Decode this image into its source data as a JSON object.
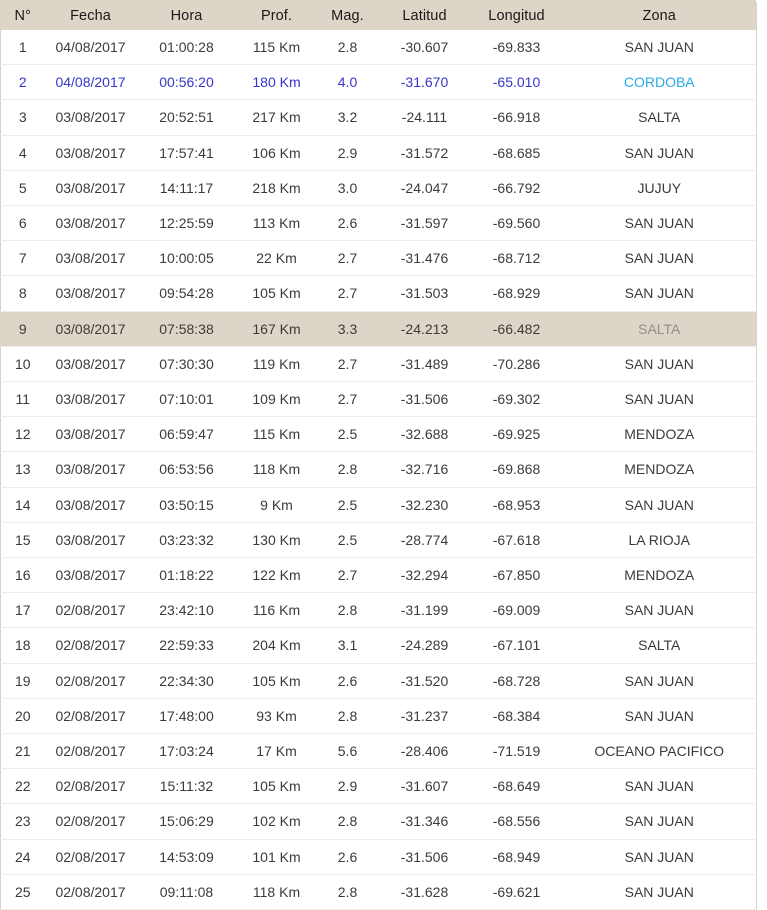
{
  "table": {
    "columns": [
      {
        "key": "num",
        "label": "N°"
      },
      {
        "key": "fecha",
        "label": "Fecha"
      },
      {
        "key": "hora",
        "label": "Hora"
      },
      {
        "key": "prof",
        "label": "Prof."
      },
      {
        "key": "mag",
        "label": "Mag."
      },
      {
        "key": "lat",
        "label": "Latitud"
      },
      {
        "key": "lon",
        "label": "Longitud"
      },
      {
        "key": "zona",
        "label": "Zona"
      }
    ],
    "colors": {
      "header_background": "#ddd5c7",
      "row_highlight_background": "#ddd5c7",
      "blue_row_text": "#3636cc",
      "blue_row_zone_text": "#2aabe4",
      "zone_text": "#8e8e8e",
      "body_text": "#3b3b3b",
      "row_separator": "#efece5"
    },
    "rows": [
      {
        "num": "1",
        "fecha": "04/08/2017",
        "hora": "01:00:28",
        "prof": "115 Km",
        "mag": "2.8",
        "lat": "-30.607",
        "lon": "-69.833",
        "zona": "SAN JUAN",
        "style": "normal"
      },
      {
        "num": "2",
        "fecha": "04/08/2017",
        "hora": "00:56:20",
        "prof": "180 Km",
        "mag": "4.0",
        "lat": "-31.670",
        "lon": "-65.010",
        "zona": "CORDOBA",
        "style": "blue"
      },
      {
        "num": "3",
        "fecha": "03/08/2017",
        "hora": "20:52:51",
        "prof": "217 Km",
        "mag": "3.2",
        "lat": "-24.111",
        "lon": "-66.918",
        "zona": "SALTA",
        "style": "normal"
      },
      {
        "num": "4",
        "fecha": "03/08/2017",
        "hora": "17:57:41",
        "prof": "106 Km",
        "mag": "2.9",
        "lat": "-31.572",
        "lon": "-68.685",
        "zona": "SAN JUAN",
        "style": "normal"
      },
      {
        "num": "5",
        "fecha": "03/08/2017",
        "hora": "14:11:17",
        "prof": "218 Km",
        "mag": "3.0",
        "lat": "-24.047",
        "lon": "-66.792",
        "zona": "JUJUY",
        "style": "normal"
      },
      {
        "num": "6",
        "fecha": "03/08/2017",
        "hora": "12:25:59",
        "prof": "113 Km",
        "mag": "2.6",
        "lat": "-31.597",
        "lon": "-69.560",
        "zona": "SAN JUAN",
        "style": "normal"
      },
      {
        "num": "7",
        "fecha": "03/08/2017",
        "hora": "10:00:05",
        "prof": "22 Km",
        "mag": "2.7",
        "lat": "-31.476",
        "lon": "-68.712",
        "zona": "SAN JUAN",
        "style": "normal"
      },
      {
        "num": "8",
        "fecha": "03/08/2017",
        "hora": "09:54:28",
        "prof": "105 Km",
        "mag": "2.7",
        "lat": "-31.503",
        "lon": "-68.929",
        "zona": "SAN JUAN",
        "style": "normal"
      },
      {
        "num": "9",
        "fecha": "03/08/2017",
        "hora": "07:58:38",
        "prof": "167 Km",
        "mag": "3.3",
        "lat": "-24.213",
        "lon": "-66.482",
        "zona": "SALTA",
        "style": "highlight"
      },
      {
        "num": "10",
        "fecha": "03/08/2017",
        "hora": "07:30:30",
        "prof": "119 Km",
        "mag": "2.7",
        "lat": "-31.489",
        "lon": "-70.286",
        "zona": "SAN JUAN",
        "style": "normal"
      },
      {
        "num": "11",
        "fecha": "03/08/2017",
        "hora": "07:10:01",
        "prof": "109 Km",
        "mag": "2.7",
        "lat": "-31.506",
        "lon": "-69.302",
        "zona": "SAN JUAN",
        "style": "normal"
      },
      {
        "num": "12",
        "fecha": "03/08/2017",
        "hora": "06:59:47",
        "prof": "115 Km",
        "mag": "2.5",
        "lat": "-32.688",
        "lon": "-69.925",
        "zona": "MENDOZA",
        "style": "normal"
      },
      {
        "num": "13",
        "fecha": "03/08/2017",
        "hora": "06:53:56",
        "prof": "118 Km",
        "mag": "2.8",
        "lat": "-32.716",
        "lon": "-69.868",
        "zona": "MENDOZA",
        "style": "normal"
      },
      {
        "num": "14",
        "fecha": "03/08/2017",
        "hora": "03:50:15",
        "prof": "9 Km",
        "mag": "2.5",
        "lat": "-32.230",
        "lon": "-68.953",
        "zona": "SAN JUAN",
        "style": "normal"
      },
      {
        "num": "15",
        "fecha": "03/08/2017",
        "hora": "03:23:32",
        "prof": "130 Km",
        "mag": "2.5",
        "lat": "-28.774",
        "lon": "-67.618",
        "zona": "LA RIOJA",
        "style": "normal"
      },
      {
        "num": "16",
        "fecha": "03/08/2017",
        "hora": "01:18:22",
        "prof": "122 Km",
        "mag": "2.7",
        "lat": "-32.294",
        "lon": "-67.850",
        "zona": "MENDOZA",
        "style": "normal"
      },
      {
        "num": "17",
        "fecha": "02/08/2017",
        "hora": "23:42:10",
        "prof": "116 Km",
        "mag": "2.8",
        "lat": "-31.199",
        "lon": "-69.009",
        "zona": "SAN JUAN",
        "style": "normal"
      },
      {
        "num": "18",
        "fecha": "02/08/2017",
        "hora": "22:59:33",
        "prof": "204 Km",
        "mag": "3.1",
        "lat": "-24.289",
        "lon": "-67.101",
        "zona": "SALTA",
        "style": "normal"
      },
      {
        "num": "19",
        "fecha": "02/08/2017",
        "hora": "22:34:30",
        "prof": "105 Km",
        "mag": "2.6",
        "lat": "-31.520",
        "lon": "-68.728",
        "zona": "SAN JUAN",
        "style": "normal"
      },
      {
        "num": "20",
        "fecha": "02/08/2017",
        "hora": "17:48:00",
        "prof": "93 Km",
        "mag": "2.8",
        "lat": "-31.237",
        "lon": "-68.384",
        "zona": "SAN JUAN",
        "style": "normal"
      },
      {
        "num": "21",
        "fecha": "02/08/2017",
        "hora": "17:03:24",
        "prof": "17 Km",
        "mag": "5.6",
        "lat": "-28.406",
        "lon": "-71.519",
        "zona": "OCEANO PACIFICO",
        "style": "normal"
      },
      {
        "num": "22",
        "fecha": "02/08/2017",
        "hora": "15:11:32",
        "prof": "105 Km",
        "mag": "2.9",
        "lat": "-31.607",
        "lon": "-68.649",
        "zona": "SAN JUAN",
        "style": "normal"
      },
      {
        "num": "23",
        "fecha": "02/08/2017",
        "hora": "15:06:29",
        "prof": "102 Km",
        "mag": "2.8",
        "lat": "-31.346",
        "lon": "-68.556",
        "zona": "SAN JUAN",
        "style": "normal"
      },
      {
        "num": "24",
        "fecha": "02/08/2017",
        "hora": "14:53:09",
        "prof": "101 Km",
        "mag": "2.6",
        "lat": "-31.506",
        "lon": "-68.949",
        "zona": "SAN JUAN",
        "style": "normal"
      },
      {
        "num": "25",
        "fecha": "02/08/2017",
        "hora": "09:11:08",
        "prof": "118 Km",
        "mag": "2.8",
        "lat": "-31.628",
        "lon": "-69.621",
        "zona": "SAN JUAN",
        "style": "normal"
      }
    ]
  }
}
